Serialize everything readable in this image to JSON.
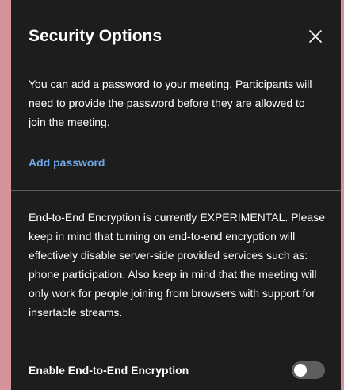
{
  "dialog": {
    "title": "Security Options",
    "close_icon": "close-icon"
  },
  "password": {
    "description": "You can add a password to your meeting. Participants will need to provide the password before they are allowed to join the meeting.",
    "add_label": "Add password"
  },
  "e2ee": {
    "description": "End-to-End Encryption is currently EXPERIMENTAL. Please keep in mind that turning on end-to-end encryption will effectively disable server-side provided services such as: phone participation. Also keep in mind that the meeting will only work for people joining from browsers with support for insertable streams.",
    "toggle_label": "Enable End-to-End Encryption",
    "enabled": false
  },
  "colors": {
    "dialog_bg": "#1d1d1d",
    "link": "#6fa8e6",
    "backdrop": "#d4949a",
    "toggle_off": "#5e5e5e"
  }
}
